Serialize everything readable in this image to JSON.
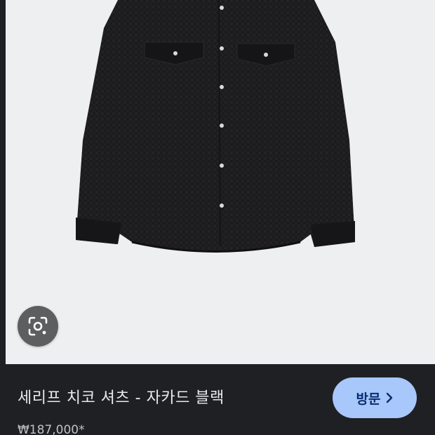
{
  "product": {
    "title": "세리프 치코 셔츠 - 자카드 블랙",
    "price": "₩187,000*"
  },
  "actions": {
    "visit_label": "방문"
  },
  "icons": {
    "lens": "google-lens-icon",
    "visit_chevron": "chevron-right-icon"
  },
  "colors": {
    "panel_bg": "#1f2023",
    "image_bg": "#eeeff1",
    "visit_button_bg": "#a8c7fa",
    "visit_button_text": "#062e6f",
    "title_text": "#e8eaed",
    "shirt": "#1a1a1c"
  }
}
